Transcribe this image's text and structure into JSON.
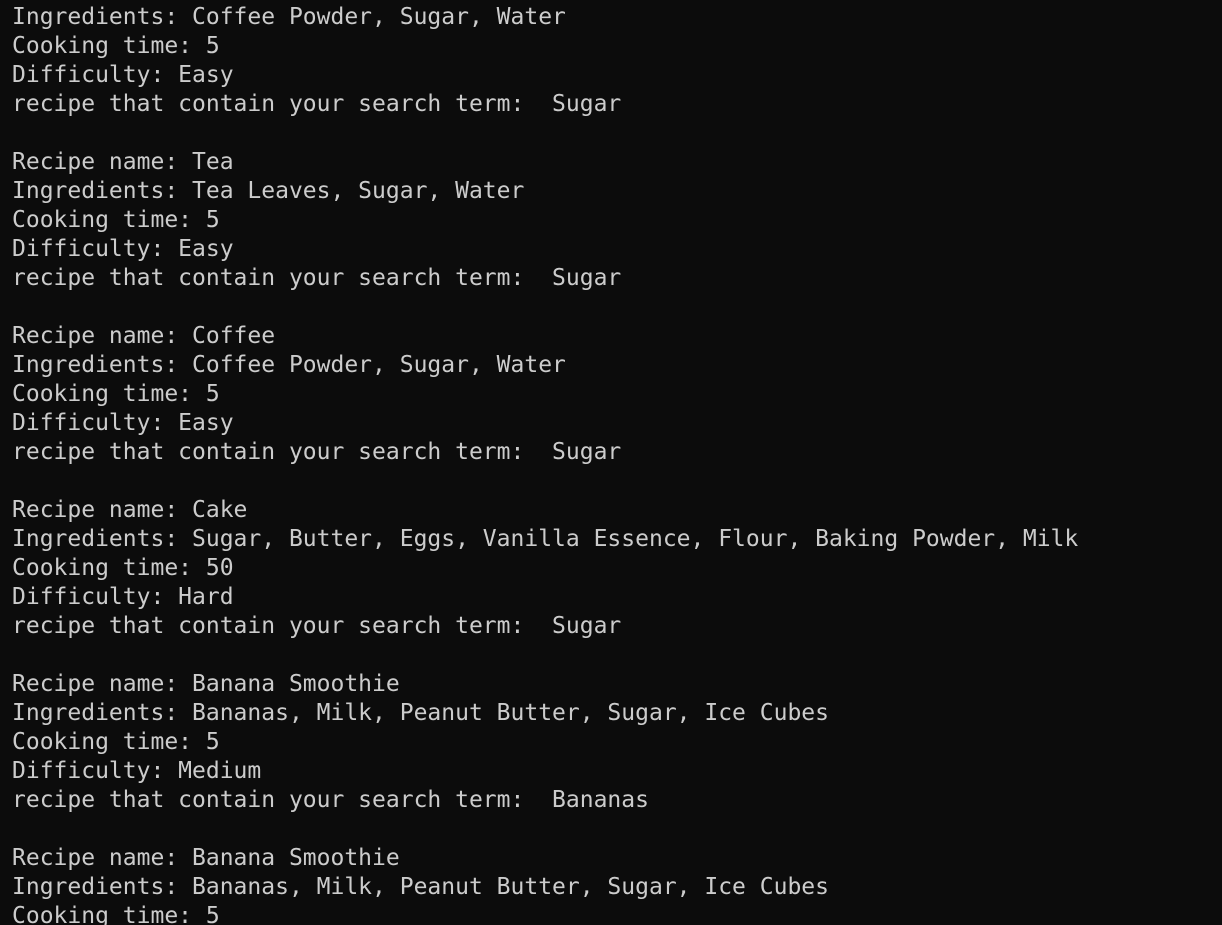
{
  "colors": {
    "background": "#0c0c0c",
    "text": "#cccccc"
  },
  "terminal": {
    "lines": [
      "Ingredients: Coffee Powder, Sugar, Water",
      "Cooking time: 5",
      "Difficulty: Easy",
      "recipe that contain your search term:  Sugar",
      "",
      "Recipe name: Tea",
      "Ingredients: Tea Leaves, Sugar, Water",
      "Cooking time: 5",
      "Difficulty: Easy",
      "recipe that contain your search term:  Sugar",
      "",
      "Recipe name: Coffee",
      "Ingredients: Coffee Powder, Sugar, Water",
      "Cooking time: 5",
      "Difficulty: Easy",
      "recipe that contain your search term:  Sugar",
      "",
      "Recipe name: Cake",
      "Ingredients: Sugar, Butter, Eggs, Vanilla Essence, Flour, Baking Powder, Milk",
      "Cooking time: 50",
      "Difficulty: Hard",
      "recipe that contain your search term:  Sugar",
      "",
      "Recipe name: Banana Smoothie",
      "Ingredients: Bananas, Milk, Peanut Butter, Sugar, Ice Cubes",
      "Cooking time: 5",
      "Difficulty: Medium",
      "recipe that contain your search term:  Bananas",
      "",
      "Recipe name: Banana Smoothie",
      "Ingredients: Bananas, Milk, Peanut Butter, Sugar, Ice Cubes",
      "Cooking time: 5"
    ]
  }
}
